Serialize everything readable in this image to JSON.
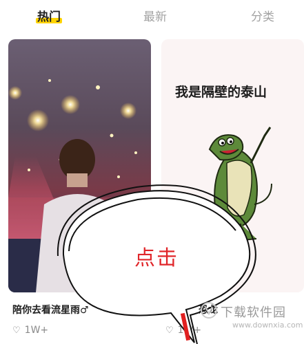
{
  "tabs": [
    {
      "label": "热门",
      "active": true
    },
    {
      "label": "最新",
      "active": false
    },
    {
      "label": "分类",
      "active": false
    }
  ],
  "cards": [
    {
      "caption": "陪你去看流星雨♂",
      "likes": "1W+"
    },
    {
      "image_text": "我是隔壁的泰山",
      "caption": "恐龙",
      "likes": "1W+"
    }
  ],
  "overlay": {
    "text": "点击"
  },
  "watermark": {
    "title": "下载软件园",
    "url": "www.downxia.com"
  },
  "colors": {
    "accent": "#ffd400",
    "overlay_text": "#e0262a"
  }
}
